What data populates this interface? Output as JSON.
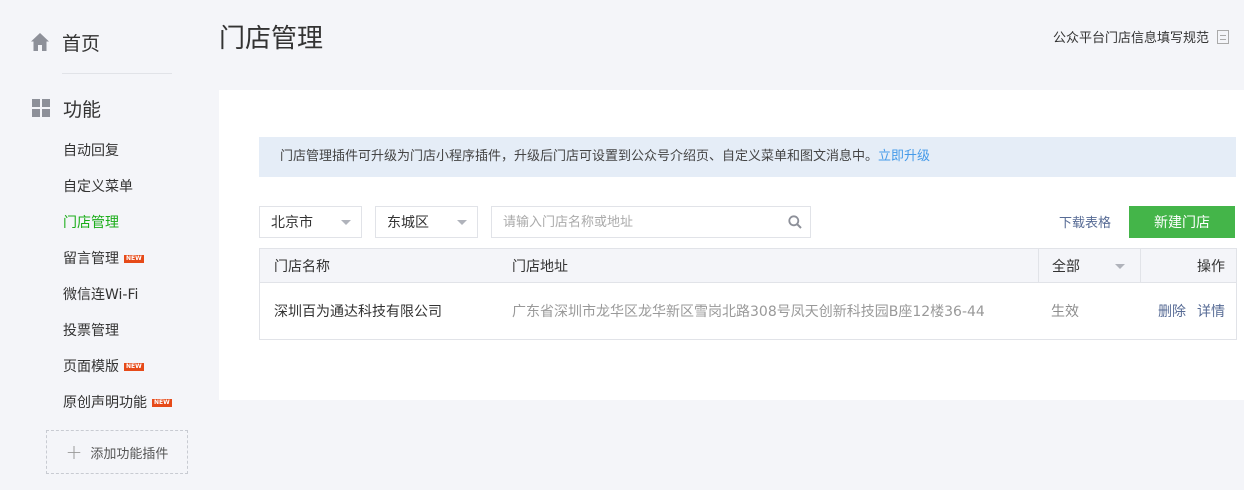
{
  "sidebar": {
    "home_label": "首页",
    "function_label": "功能",
    "items": [
      {
        "label": "自动回复",
        "is_new": false,
        "active": false
      },
      {
        "label": "自定义菜单",
        "is_new": false,
        "active": false
      },
      {
        "label": "门店管理",
        "is_new": false,
        "active": true
      },
      {
        "label": "留言管理",
        "is_new": true,
        "active": false
      },
      {
        "label": "微信连Wi-Fi",
        "is_new": false,
        "active": false
      },
      {
        "label": "投票管理",
        "is_new": false,
        "active": false
      },
      {
        "label": "页面模版",
        "is_new": true,
        "active": false
      },
      {
        "label": "原创声明功能",
        "is_new": true,
        "active": false
      }
    ],
    "new_badge_text": "NEW",
    "add_plugin_label": "添加功能插件"
  },
  "header": {
    "title": "门店管理",
    "spec_link": "公众平台门店信息填写规范"
  },
  "notice": {
    "text": "门店管理插件可升级为门店小程序插件，升级后门店可设置到公众号介绍页、自定义菜单和图文消息中。",
    "link": "立即升级"
  },
  "filters": {
    "city": "北京市",
    "district": "东城区",
    "search_placeholder": "请输入门店名称或地址",
    "search_value": ""
  },
  "actions": {
    "download": "下载表格",
    "new_store": "新建门店"
  },
  "table": {
    "headers": {
      "name": "门店名称",
      "address": "门店地址",
      "status": "全部",
      "ops": "操作"
    },
    "rows": [
      {
        "name": "深圳百为通达科技有限公司",
        "address": "广东省深圳市龙华区龙华新区雪岗北路308号凤天创新科技园B座12楼36-44",
        "status": "生效",
        "delete": "删除",
        "detail": "详情"
      }
    ]
  },
  "colors": {
    "accent_green": "#44b549",
    "active_menu": "#1aad19",
    "link_blue": "#576b95",
    "notice_bg": "#e5edf7",
    "new_badge": "#e64a19"
  }
}
